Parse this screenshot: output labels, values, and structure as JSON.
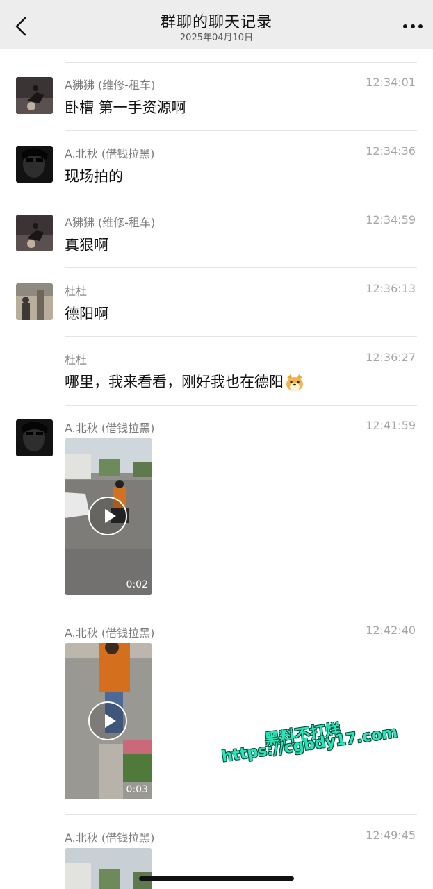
{
  "header": {
    "title": "群聊的聊天记录",
    "date": "2025年04月10日"
  },
  "messages": [
    {
      "sender": "A狒狒 (维修-租车)",
      "time": "12:34:01",
      "text": "卧槽  第一手资源啊"
    },
    {
      "sender": "A.北秋 (借钱拉黑)",
      "time": "12:34:36",
      "text": "现场拍的"
    },
    {
      "sender": "A狒狒 (维修-租车)",
      "time": "12:34:59",
      "text": "真狠啊"
    },
    {
      "sender": "杜杜",
      "time": "12:36:13",
      "text": "德阳啊"
    },
    {
      "sender": "杜杜",
      "time": "12:36:27",
      "text": "哪里，我来看看，刚好我也在德阳"
    },
    {
      "sender": "A.北秋 (借钱拉黑)",
      "time": "12:41:59",
      "duration": "0:02"
    },
    {
      "sender": "A.北秋 (借钱拉黑)",
      "time": "12:42:40",
      "duration": "0:03"
    },
    {
      "sender": "A.北秋 (借钱拉黑)",
      "time": "12:49:45"
    }
  ],
  "watermark": {
    "line1": "黑料不打烊",
    "line2": "https://cgbdy17.com"
  },
  "icons": [
    "back-arrow-icon",
    "more-dots-icon",
    "play-icon",
    "dog-emoji-icon"
  ],
  "colors": {
    "header_bg": "#ededed",
    "watermark": "#29e6b8"
  }
}
